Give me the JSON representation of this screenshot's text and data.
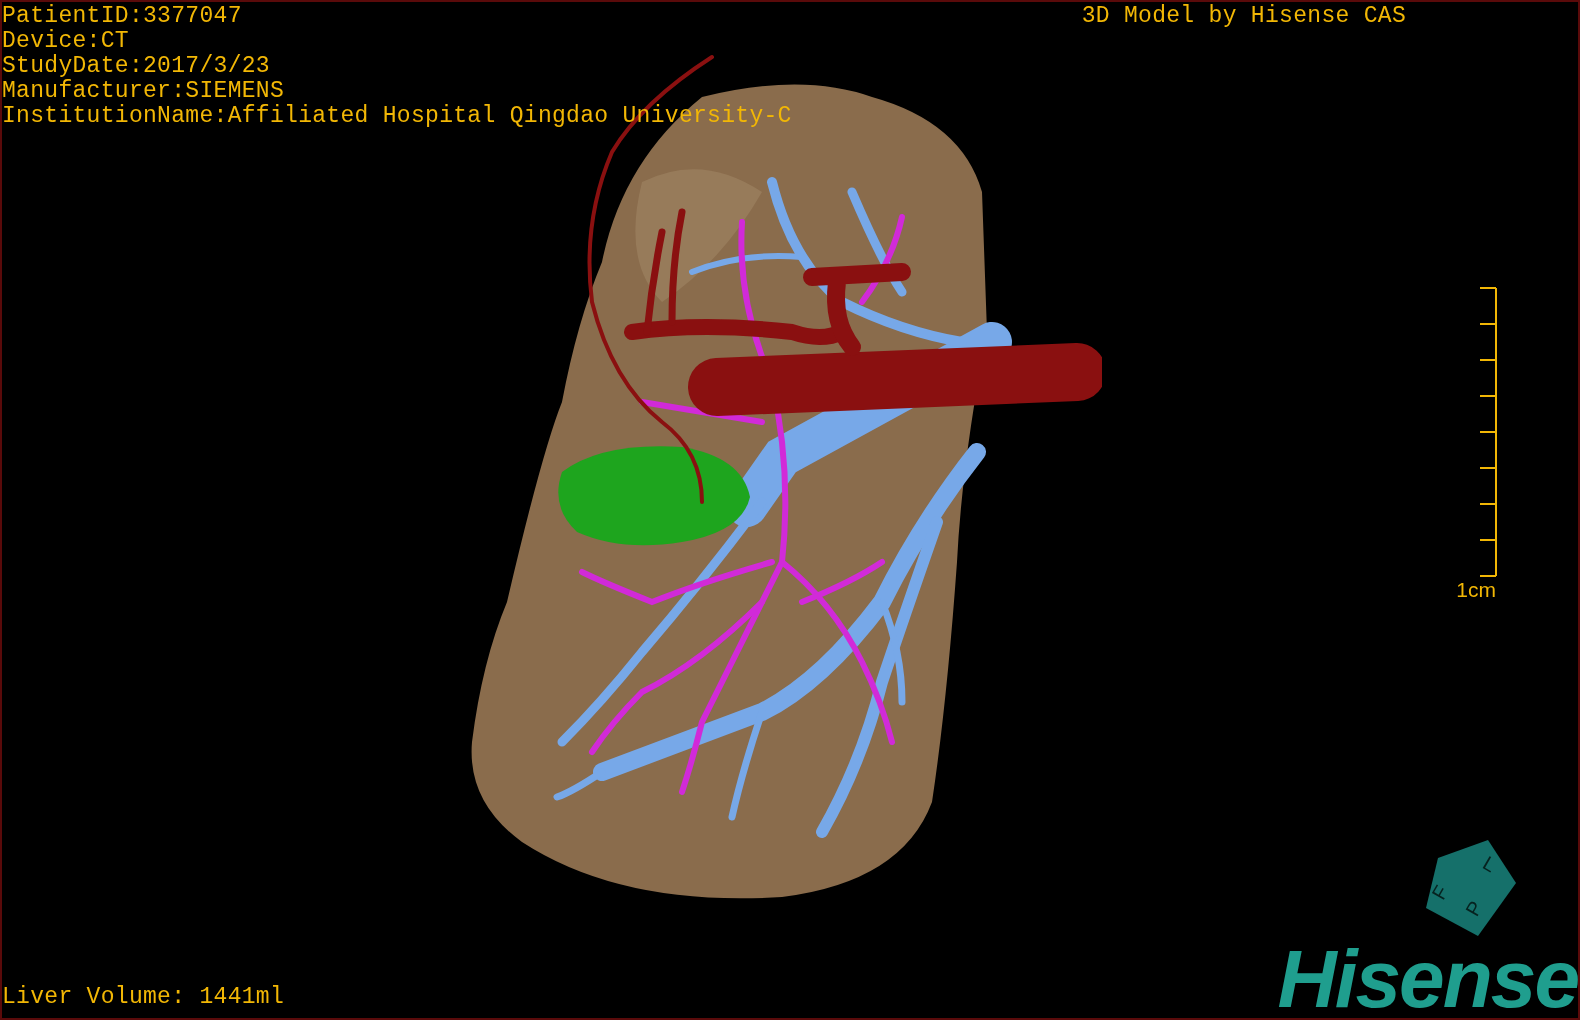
{
  "patient_info": [
    "PatientID:3377047",
    "Device:CT",
    "StudyDate:2017/3/23",
    "Manufacturer:SIEMENS",
    "InstitutionName:Affiliated Hospital Qingdao University-C"
  ],
  "title": "3D Model by Hisense CAS",
  "scale_bar": {
    "label": "1cm"
  },
  "orientation_cube": {
    "faces": [
      "F",
      "L",
      "P"
    ]
  },
  "liver_volume": "Liver Volume: 1441ml",
  "logo": "Hisense"
}
